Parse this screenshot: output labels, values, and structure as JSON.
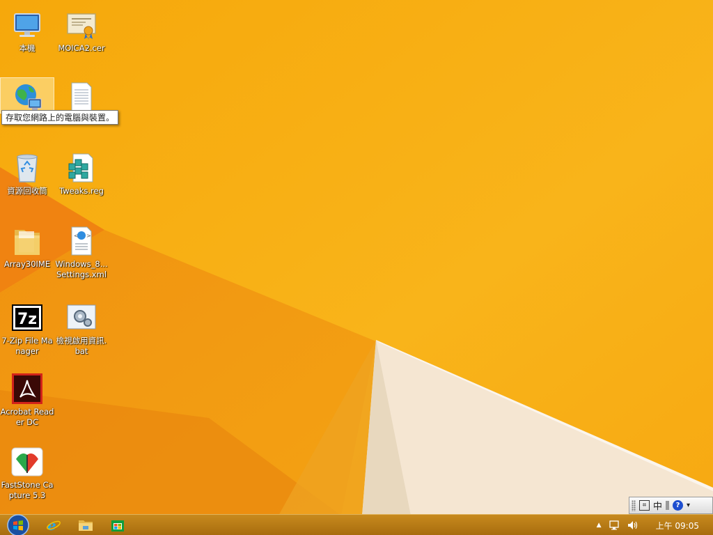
{
  "desktop": {
    "icons": [
      {
        "label": "本機",
        "icon": "this-pc-icon"
      },
      {
        "label": "MOICA2.cer",
        "icon": "certificate-icon"
      },
      {
        "label": "",
        "icon": "network-icon"
      },
      {
        "label": "",
        "icon": "text-file-icon"
      },
      {
        "label": "資源回收筒",
        "icon": "recycle-bin-icon"
      },
      {
        "label": "Tweaks.reg",
        "icon": "registry-file-icon"
      },
      {
        "label": "Array30IME",
        "icon": "folder-icon"
      },
      {
        "label": "Windows_8... Settings.xml",
        "icon": "xml-file-icon"
      },
      {
        "label": "7-Zip File Manager",
        "icon": "7zip-icon"
      },
      {
        "label": "檢視啟用資訊.bat",
        "icon": "batch-file-icon"
      },
      {
        "label": "Acrobat Reader DC",
        "icon": "acrobat-icon"
      },
      {
        "label": "FastStone Capture 5.3",
        "icon": "faststone-icon"
      }
    ],
    "tooltip": "存取您網路上的電腦與裝置。"
  },
  "ime_bar": {
    "mode_label": "中",
    "help_label": "?"
  },
  "taskbar": {
    "pinned": [
      "internet-explorer-icon",
      "file-explorer-icon",
      "store-icon"
    ],
    "clock": "上午 09:05"
  },
  "colors": {
    "wallpaper": "#F7A90E",
    "taskbar": "#B8790F",
    "tooltip_bg": "#FFFFFF"
  }
}
